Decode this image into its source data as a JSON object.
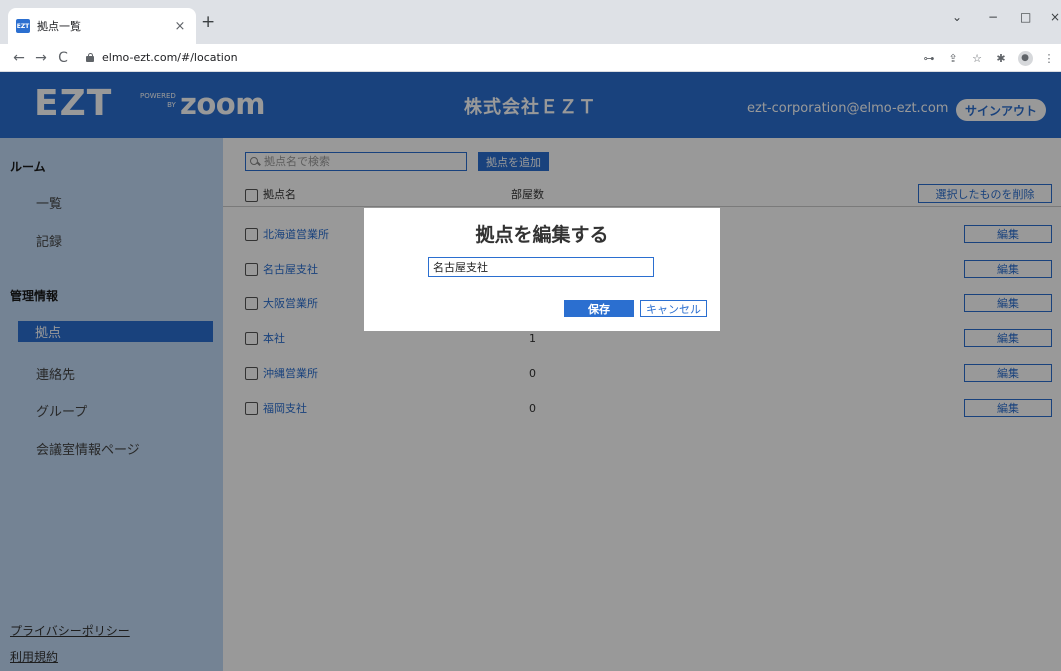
{
  "browser": {
    "tab_title": "拠点一覧",
    "favicon_text": "EZT",
    "tab_close": "×",
    "new_tab": "+",
    "url": "elmo-ezt.com/#/location",
    "back": "←",
    "forward": "→",
    "reload": "C",
    "window_controls": {
      "minimize_chevron": "⌄",
      "minimize": "−",
      "maximize": "□",
      "close": "×"
    },
    "toolbar_icons": {
      "key": "⊶",
      "share": "⇪",
      "star": "☆",
      "extensions": "✱",
      "profile": "●",
      "menu": "⋮"
    }
  },
  "header": {
    "logo": "EZT",
    "powered_by": "POWERED",
    "by": "BY",
    "zoom": "zoom",
    "company": "株式会社ＥＺＴ",
    "email": "ezt-corporation@elmo-ezt.com",
    "signout": "サインアウト"
  },
  "sidebar": {
    "section_room": "ルーム",
    "item_list": "一覧",
    "item_record": "記録",
    "section_admin": "管理情報",
    "item_location": "拠点",
    "item_contacts": "連絡先",
    "item_group": "グループ",
    "item_meeting_info": "会議室情報ページ",
    "link_privacy": "プライバシーポリシー",
    "link_terms": "利用規約"
  },
  "main": {
    "search_placeholder": "拠点名で検索",
    "add_button": "拠点を追加",
    "delete_selected": "選択したものを削除",
    "col_name": "拠点名",
    "col_rooms": "部屋数",
    "edit_label": "編集",
    "rows": [
      {
        "name": "北海道営業所",
        "count": ""
      },
      {
        "name": "名古屋支社",
        "count": ""
      },
      {
        "name": "大阪営業所",
        "count": ""
      },
      {
        "name": "本社",
        "count": "1"
      },
      {
        "name": "沖縄営業所",
        "count": "0"
      },
      {
        "name": "福岡支社",
        "count": "0"
      }
    ]
  },
  "modal": {
    "title": "拠点を編集する",
    "input_value": "名古屋支社",
    "save": "保存",
    "cancel": "キャンセル"
  },
  "colors": {
    "brand_blue": "#2b6fd0",
    "sidebar_bg": "#c2dbf7",
    "overlay": "rgba(0,0,0,0.4)"
  }
}
